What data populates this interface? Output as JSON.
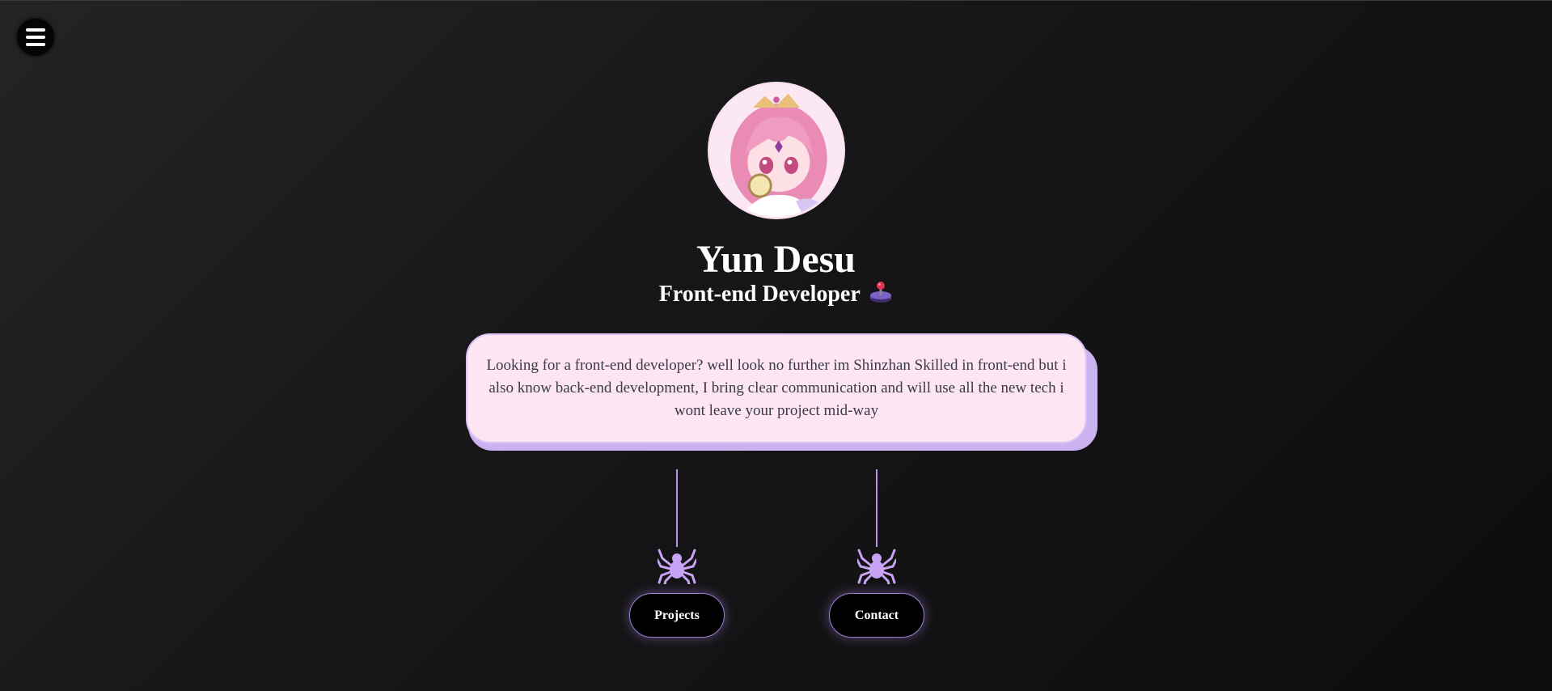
{
  "profile": {
    "name": "Yun Desu",
    "role": "Front-end Developer",
    "bio": "Looking for a front-end developer? well look no further im Shinzhan Skilled in front-end but i also know back-end development, I bring clear communication and will use all the new tech i wont leave your project mid-way"
  },
  "nav": {
    "projects_label": "Projects",
    "contact_label": "Contact"
  },
  "icons": {
    "menu": "hamburger-menu-icon",
    "role_emoji": "joystick-icon",
    "decoration": "spider-icon"
  },
  "colors": {
    "background": "#161618",
    "card": "#fde5f2",
    "card_shadow": "#cbb2f0",
    "accent": "#b993e8",
    "button_bg": "#000000"
  }
}
